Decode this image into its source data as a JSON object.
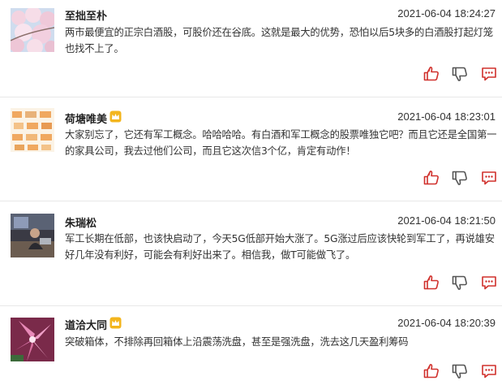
{
  "accent_color": "#d0302c",
  "icons": {
    "like": "thumbs-up-icon",
    "dislike": "thumbs-down-icon",
    "reply": "comment-icon",
    "vip": "crown-icon"
  },
  "posts": [
    {
      "user": "至拙至朴",
      "time": "2021-06-04 18:24:27",
      "vip": false,
      "content": "两市最便宜的正宗白酒股，可股价还在谷底。这就是最大的优势，恐怕以后5块多的白酒股打起灯笼也找不上了。"
    },
    {
      "user": "荷塘唯美",
      "time": "2021-06-04 18:23:01",
      "vip": true,
      "content": "大家别忘了，它还有军工概念。哈哈哈哈。有白酒和军工概念的股票唯独它吧？而且它还是全国第一的家具公司，我去过他们公司，而且它这次信3个亿，肯定有动作！"
    },
    {
      "user": "朱瑞松",
      "time": "2021-06-04 18:21:50",
      "vip": false,
      "content": "军工长期在低部，也该快启动了，今天5G低部开始大涨了。5G涨过后应该快轮到军工了，再说雄安好几年没有利好，可能会有利好出来了。相信我，做T可能做飞了。"
    },
    {
      "user": "道洽大同",
      "time": "2021-06-04 18:20:39",
      "vip": true,
      "content": "突破箱体，不排除再回箱体上沿震荡洗盘，甚至是强洗盘，洗去这几天盈利筹码"
    }
  ]
}
